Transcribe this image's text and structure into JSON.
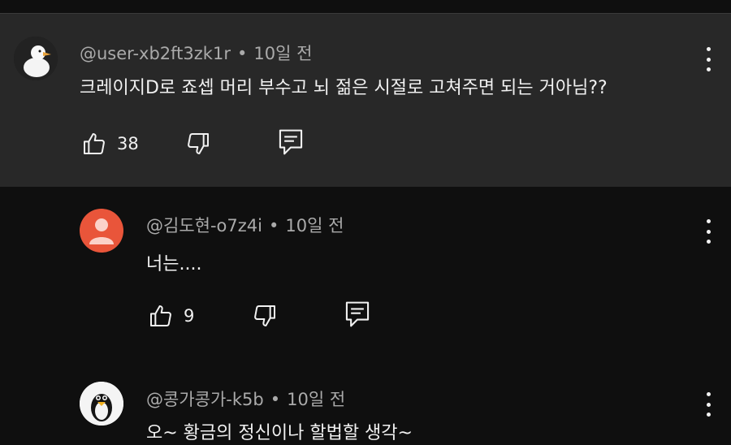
{
  "comments": [
    {
      "author": "@user-xb2ft3zk1r",
      "time": "10일 전",
      "text": "크레이지D로 죠셉 머리 부수고 뇌 젊은 시절로 고쳐주면 되는 거아님??",
      "likes": "38",
      "avatar_icon": "duck-avatar-icon"
    },
    {
      "author": "@김도현-o7z4i",
      "time": "10일 전",
      "text": "너는....",
      "likes": "9",
      "avatar_icon": "default-user-avatar-icon"
    },
    {
      "author": "@콩가콩가-k5b",
      "time": "10일 전",
      "text": "오~ 황금의 정신이나 할법할 생각~",
      "avatar_icon": "penguin-avatar-icon"
    }
  ],
  "separator": "•",
  "colors": {
    "background": "#0f0f0f",
    "highlighted_comment_bg": "#282828",
    "meta_text": "#aaaaaa",
    "default_avatar": "#e9553a"
  }
}
